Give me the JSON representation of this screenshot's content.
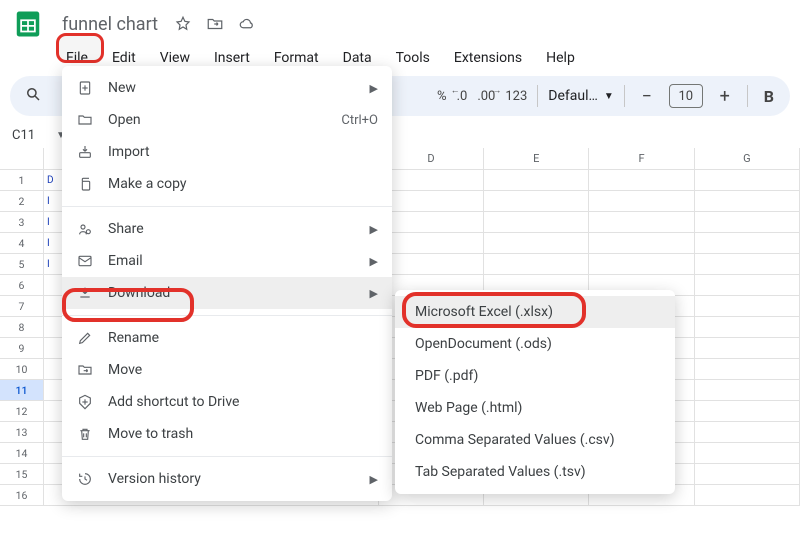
{
  "doc": {
    "title": "funnel chart"
  },
  "menubar": [
    "File",
    "Edit",
    "View",
    "Insert",
    "Format",
    "Data",
    "Tools",
    "Extensions",
    "Help"
  ],
  "toolbar": {
    "percent": "%",
    "dec_dec": ".0",
    "dec_inc": ".00",
    "numfmt": "123",
    "font": "Defaul…",
    "size": "10",
    "bold": "B"
  },
  "namebox": "C11",
  "columns": [
    "D",
    "E",
    "F",
    "G"
  ],
  "rows": [
    "1",
    "2",
    "3",
    "4",
    "5",
    "6",
    "7",
    "8",
    "9",
    "10",
    "11",
    "12",
    "13",
    "14",
    "15",
    "16"
  ],
  "stub_a": [
    "D",
    "I",
    "I",
    "I",
    "I",
    "",
    "",
    "",
    "",
    "",
    "",
    "",
    "",
    "",
    "",
    ""
  ],
  "file_menu": {
    "new": "New",
    "open": "Open",
    "open_sc": "Ctrl+O",
    "import": "Import",
    "copy": "Make a copy",
    "share": "Share",
    "email": "Email",
    "download": "Download",
    "rename": "Rename",
    "move": "Move",
    "shortcut": "Add shortcut to Drive",
    "trash": "Move to trash",
    "version": "Version history"
  },
  "download_menu": {
    "xlsx": "Microsoft Excel (.xlsx)",
    "ods": "OpenDocument (.ods)",
    "pdf": "PDF (.pdf)",
    "html": "Web Page (.html)",
    "csv": "Comma Separated Values (.csv)",
    "tsv": "Tab Separated Values (.tsv)"
  },
  "annotations": {
    "file_ring": "File menu highlighted",
    "download_ring": "Download item highlighted",
    "xlsx_ring": "Microsoft Excel option highlighted"
  }
}
